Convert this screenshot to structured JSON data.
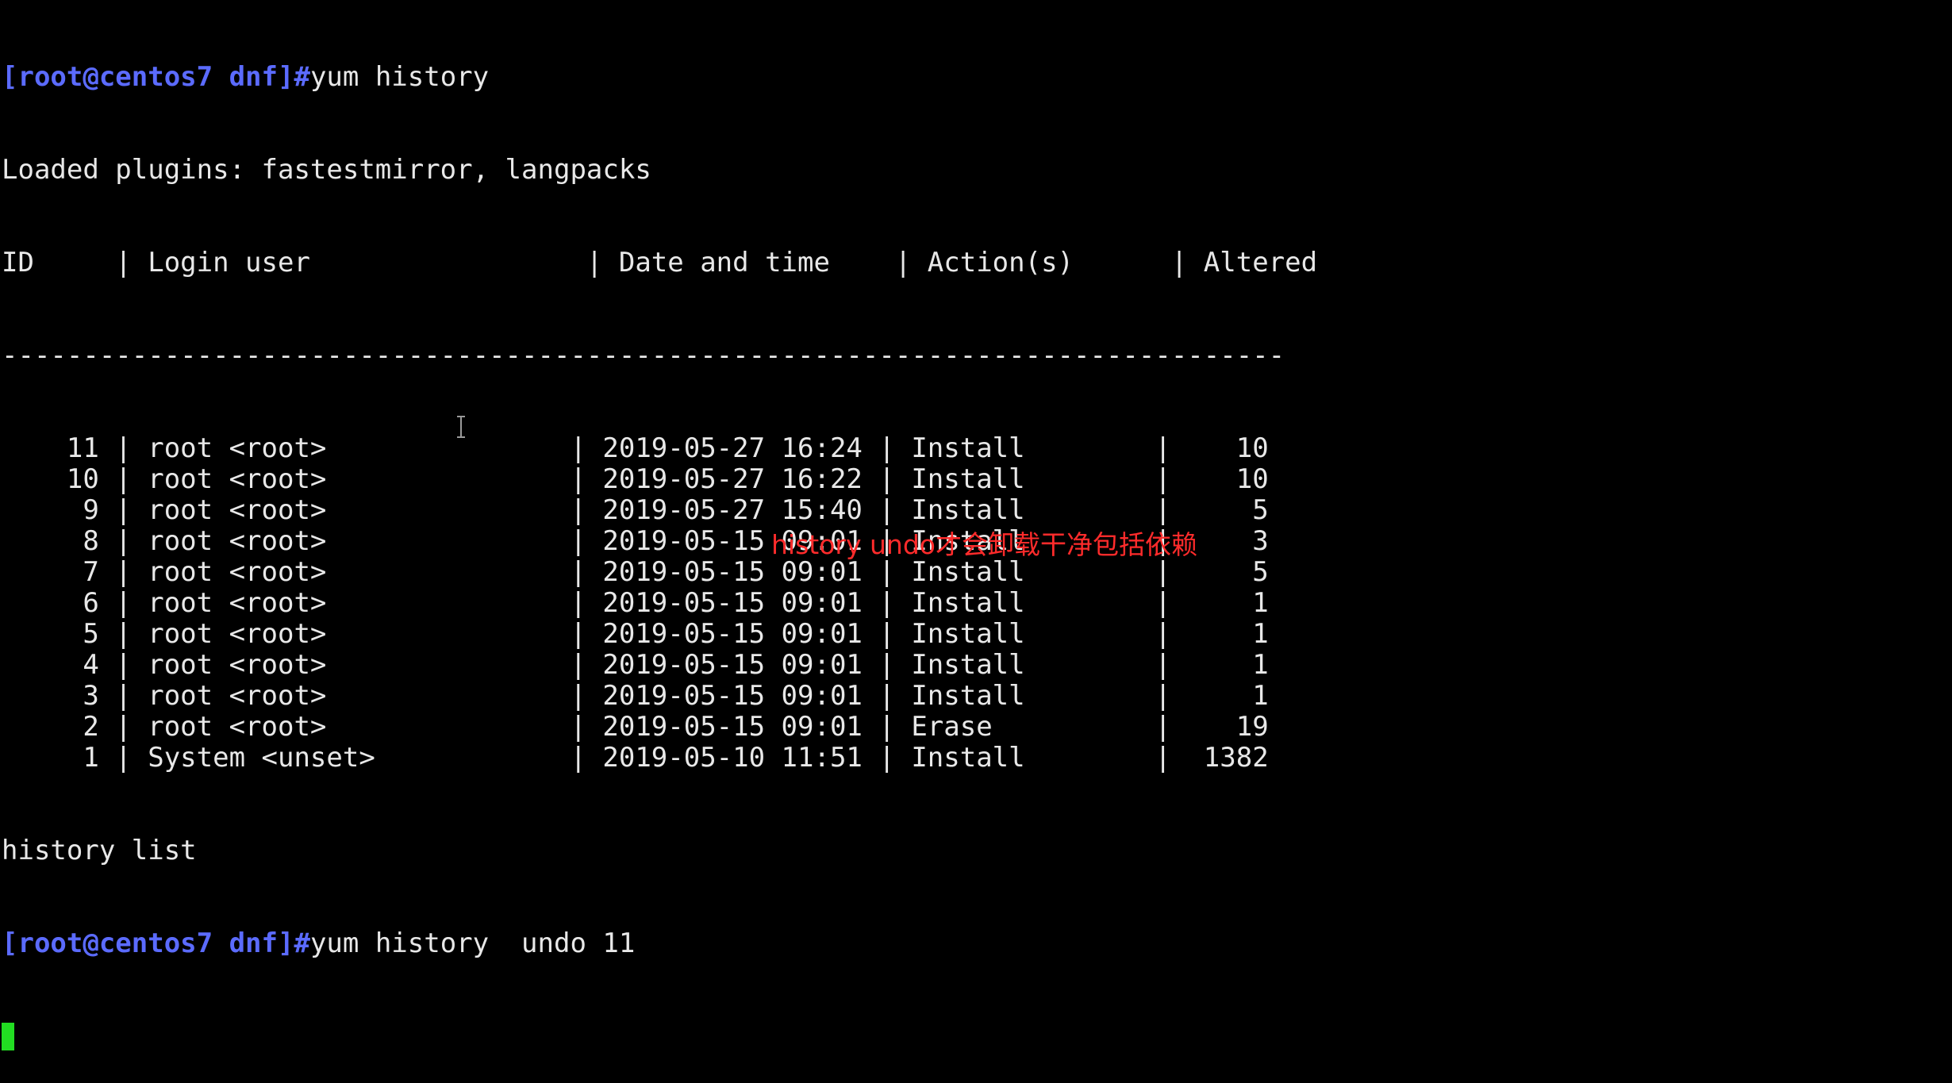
{
  "prompt": "[root@centos7 dnf]#",
  "command_1": "yum history",
  "plugins_line": "Loaded plugins: fastestmirror, langpacks",
  "table": {
    "headers": [
      "ID",
      "Login user",
      "Date and time",
      "Action(s)",
      "Altered"
    ],
    "separator": "-------------------------------------------------------------------------------",
    "rows": [
      {
        "id": "11",
        "user": "root <root>",
        "date": "2019-05-27 16:24",
        "action": "Install",
        "altered": "10"
      },
      {
        "id": "10",
        "user": "root <root>",
        "date": "2019-05-27 16:22",
        "action": "Install",
        "altered": "10"
      },
      {
        "id": "9",
        "user": "root <root>",
        "date": "2019-05-27 15:40",
        "action": "Install",
        "altered": "5"
      },
      {
        "id": "8",
        "user": "root <root>",
        "date": "2019-05-15 09:01",
        "action": "Install",
        "altered": "3"
      },
      {
        "id": "7",
        "user": "root <root>",
        "date": "2019-05-15 09:01",
        "action": "Install",
        "altered": "5"
      },
      {
        "id": "6",
        "user": "root <root>",
        "date": "2019-05-15 09:01",
        "action": "Install",
        "altered": "1"
      },
      {
        "id": "5",
        "user": "root <root>",
        "date": "2019-05-15 09:01",
        "action": "Install",
        "altered": "1"
      },
      {
        "id": "4",
        "user": "root <root>",
        "date": "2019-05-15 09:01",
        "action": "Install",
        "altered": "1"
      },
      {
        "id": "3",
        "user": "root <root>",
        "date": "2019-05-15 09:01",
        "action": "Install",
        "altered": "1"
      },
      {
        "id": "2",
        "user": "root <root>",
        "date": "2019-05-15 09:01",
        "action": "Erase",
        "altered": "19"
      },
      {
        "id": "1",
        "user": "System <unset>",
        "date": "2019-05-10 11:51",
        "action": "Install",
        "altered": "1382"
      }
    ]
  },
  "footer_line": "history list",
  "command_2": "yum history  undo 11",
  "annotation_text": "history  undo才会卸载干净包括依赖",
  "colors": {
    "background": "#000000",
    "text": "#e8e8e8",
    "prompt": "#5b6bff",
    "cursor": "#22dd22",
    "annotation": "#ff2b2b"
  }
}
